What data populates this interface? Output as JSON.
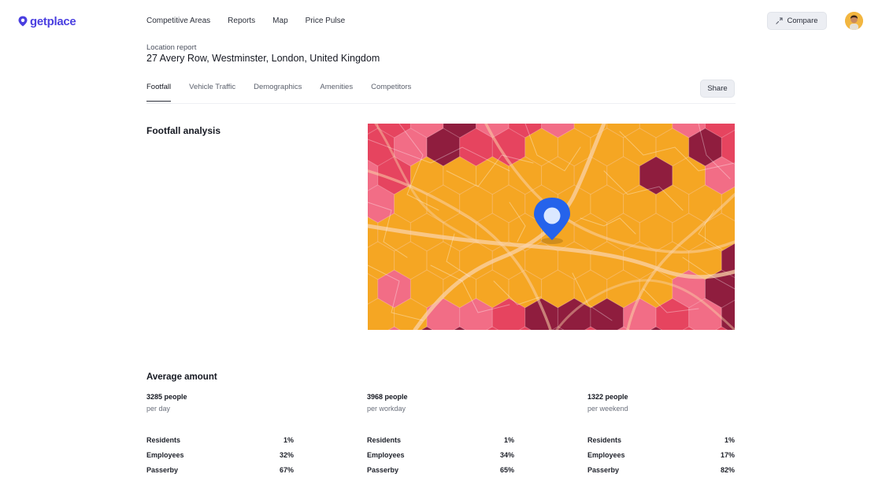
{
  "app": {
    "logo_text": "getplace"
  },
  "nav": {
    "items": [
      {
        "label": "Competitive Areas"
      },
      {
        "label": "Reports"
      },
      {
        "label": "Map"
      },
      {
        "label": "Price Pulse"
      }
    ],
    "compare_label": "Compare"
  },
  "location": {
    "label": "Location report",
    "address": "27 Avery Row, Westminster, London, United Kingdom"
  },
  "tabs": {
    "items": [
      {
        "label": "Footfall",
        "active": true
      },
      {
        "label": "Vehicle Traffic",
        "active": false
      },
      {
        "label": "Demographics",
        "active": false
      },
      {
        "label": "Amenities",
        "active": false
      },
      {
        "label": "Competitors",
        "active": false
      }
    ],
    "share_label": "Share"
  },
  "footfall": {
    "title": "Footfall analysis",
    "map": {
      "colors": {
        "orange": "#f5a623",
        "pink": "#f26d86",
        "red": "#e6445f",
        "dark": "#8f1d3e",
        "pin": "#2563eb"
      }
    }
  },
  "average": {
    "title": "Average amount",
    "columns": [
      {
        "value": "3285 people",
        "period": "per day",
        "rows": [
          {
            "label": "Residents",
            "pct": "1%"
          },
          {
            "label": "Employees",
            "pct": "32%"
          },
          {
            "label": "Passerby",
            "pct": "67%"
          }
        ]
      },
      {
        "value": "3968 people",
        "period": "per workday",
        "rows": [
          {
            "label": "Residents",
            "pct": "1%"
          },
          {
            "label": "Employees",
            "pct": "34%"
          },
          {
            "label": "Passerby",
            "pct": "65%"
          }
        ]
      },
      {
        "value": "1322 people",
        "period": "per weekend",
        "rows": [
          {
            "label": "Residents",
            "pct": "1%"
          },
          {
            "label": "Employees",
            "pct": "17%"
          },
          {
            "label": "Passerby",
            "pct": "82%"
          }
        ]
      }
    ]
  }
}
